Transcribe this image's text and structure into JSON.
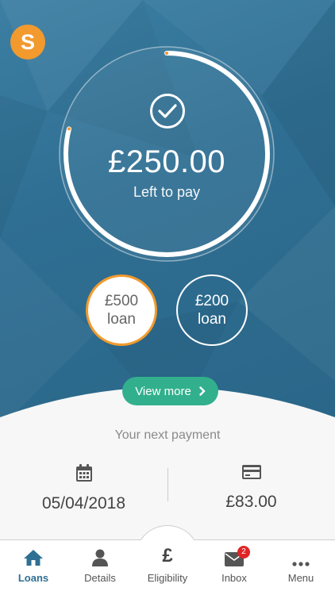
{
  "app": {
    "logo_letter": "S"
  },
  "summary": {
    "amount": "£250.00",
    "caption": "Left to pay",
    "progress_fraction": 0.79,
    "ring_color": "#ffffff",
    "marker_color": "#f29a2e"
  },
  "loans": [
    {
      "amount": "£500",
      "label": "loan",
      "selected": true
    },
    {
      "amount": "£200",
      "label": "loan",
      "selected": false
    }
  ],
  "view_more": {
    "label": "View more",
    "icon": "chevron-right-icon",
    "color": "#32b08d"
  },
  "next_payment": {
    "title": "Your next payment",
    "date": "05/04/2018",
    "date_icon": "calendar-icon",
    "amount": "£83.00",
    "amount_icon": "credit-card-icon"
  },
  "tabs": [
    {
      "label": "Loans",
      "icon": "home-icon",
      "active": true
    },
    {
      "label": "Details",
      "icon": "user-icon",
      "active": false
    },
    {
      "label": "Eligibility",
      "icon": "pound-icon",
      "active": false,
      "glyph": "£"
    },
    {
      "label": "Inbox",
      "icon": "envelope-icon",
      "active": false,
      "badge": "2"
    },
    {
      "label": "Menu",
      "icon": "more-icon",
      "active": false
    }
  ],
  "colors": {
    "hero": "#2f6f93",
    "accent": "#f29a2e",
    "active_tab": "#2f6f93"
  }
}
